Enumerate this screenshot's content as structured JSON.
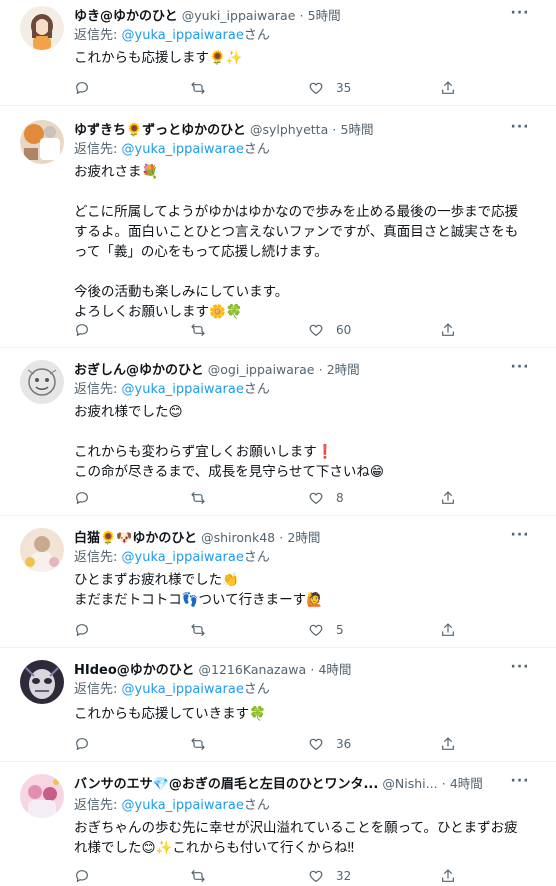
{
  "colors": {
    "accent": "#1d9bf0",
    "muted": "#536471",
    "text": "#0f1419",
    "divider": "#eff3f4"
  },
  "reply_prefix": "返信先:",
  "reply_suffix": "さん",
  "tweets": [
    {
      "name": "ゆき@ゆかのひと",
      "handle": "@yuki_ippaiwarae",
      "dot": "·",
      "time": "5時間",
      "mention": "@yuka_ippaiwarae",
      "lines": [
        "これからも応援します🌻✨"
      ],
      "likes": "35",
      "avatar_icon": "avatar-girl-illustration"
    },
    {
      "name": "ゆずきち🌻ずっとゆかのひと",
      "handle": "@sylphyetta",
      "dot": "·",
      "time": "5時間",
      "mention": "@yuka_ippaiwarae",
      "lines": [
        "お疲れさま💐",
        "",
        "どこに所属してようがゆかはゆかなので歩みを止める最後の一歩まで応援",
        "するよ。面白いことひとつ言えないファンですが、真面目さと誠実さをも",
        "って「義」の心をもって応援し続けます。",
        "",
        "今後の活動も楽しみにしています。",
        "よろしくお願いします🌼🍀"
      ],
      "likes": "60",
      "avatar_icon": "avatar-photo-orange"
    },
    {
      "name": "おぎしん@ゆかのひと",
      "handle": "@ogi_ippaiwarae",
      "dot": "·",
      "time": "2時間",
      "mention": "@yuka_ippaiwarae",
      "lines": [
        "お疲れ様でした😊",
        "",
        "これからも変わらず宜しくお願いします❗",
        "この命が尽きるまで、成長を見守らせて下さいね😁"
      ],
      "likes": "8",
      "avatar_icon": "avatar-sketch"
    },
    {
      "name": "白猫🌻🐶ゆかのひと",
      "handle": "@shironk48",
      "dot": "·",
      "time": "2時間",
      "mention": "@yuka_ippaiwarae",
      "lines": [
        "ひとまずお疲れ様でした👏",
        "まだまだトコトコ👣ついて行きまーす🙋"
      ],
      "likes": "5",
      "avatar_icon": "avatar-photo-flowers"
    },
    {
      "name": "HIdeo@ゆかのひと",
      "handle": "@1216Kanazawa",
      "dot": "·",
      "time": "4時間",
      "mention": "@yuka_ippaiwarae",
      "lines": [
        "これからも応援していきます🍀"
      ],
      "likes": "36",
      "avatar_icon": "avatar-mask"
    },
    {
      "name": "バンサのエサ💎@おぎの眉毛と左目のひとワンタ...",
      "handle": "@Nishi...",
      "dot": "·",
      "time": "4時間",
      "mention": "@yuka_ippaiwarae",
      "lines": [
        "おぎちゃんの歩む先に幸せが沢山溢れていることを願って。ひとまずお疲",
        "れ様でした😊✨これからも付いて行くからね‼"
      ],
      "likes": "32",
      "avatar_icon": "avatar-photo-pink"
    }
  ]
}
